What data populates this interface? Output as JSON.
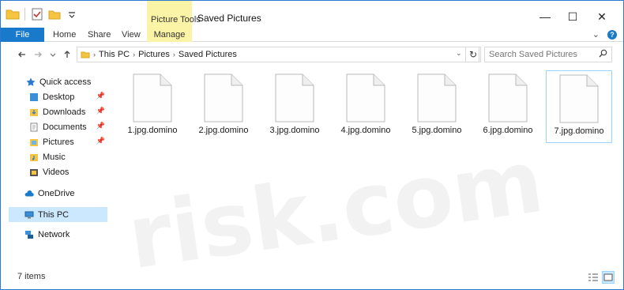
{
  "window": {
    "title": "Saved Pictures",
    "contextual_tab_group": "Picture Tools",
    "controls": {
      "minimize": "—",
      "maximize": "☐",
      "close": "✕"
    }
  },
  "ribbon": {
    "tabs": [
      {
        "label": "File"
      },
      {
        "label": "Home"
      },
      {
        "label": "Share"
      },
      {
        "label": "View"
      },
      {
        "label": "Manage"
      }
    ],
    "expand": "⌄",
    "help": "?"
  },
  "address": {
    "breadcrumb": [
      "This PC",
      "Pictures",
      "Saved Pictures"
    ]
  },
  "search": {
    "placeholder": "Search Saved Pictures"
  },
  "nav": {
    "quick_access": "Quick access",
    "items": [
      {
        "label": "Desktop",
        "pinned": true
      },
      {
        "label": "Downloads",
        "pinned": true
      },
      {
        "label": "Documents",
        "pinned": true
      },
      {
        "label": "Pictures",
        "pinned": true
      },
      {
        "label": "Music",
        "pinned": false
      },
      {
        "label": "Videos",
        "pinned": false
      }
    ],
    "onedrive": "OneDrive",
    "this_pc": "This PC",
    "network": "Network"
  },
  "files": [
    {
      "name": "1.jpg.domino"
    },
    {
      "name": "2.jpg.domino"
    },
    {
      "name": "3.jpg.domino"
    },
    {
      "name": "4.jpg.domino"
    },
    {
      "name": "5.jpg.domino"
    },
    {
      "name": "6.jpg.domino"
    },
    {
      "name": "7.jpg.domino"
    }
  ],
  "status": {
    "item_count": "7 items"
  },
  "colors": {
    "accent": "#1979ca",
    "contextual": "#fbf3a6",
    "selection": "#cce8ff"
  }
}
